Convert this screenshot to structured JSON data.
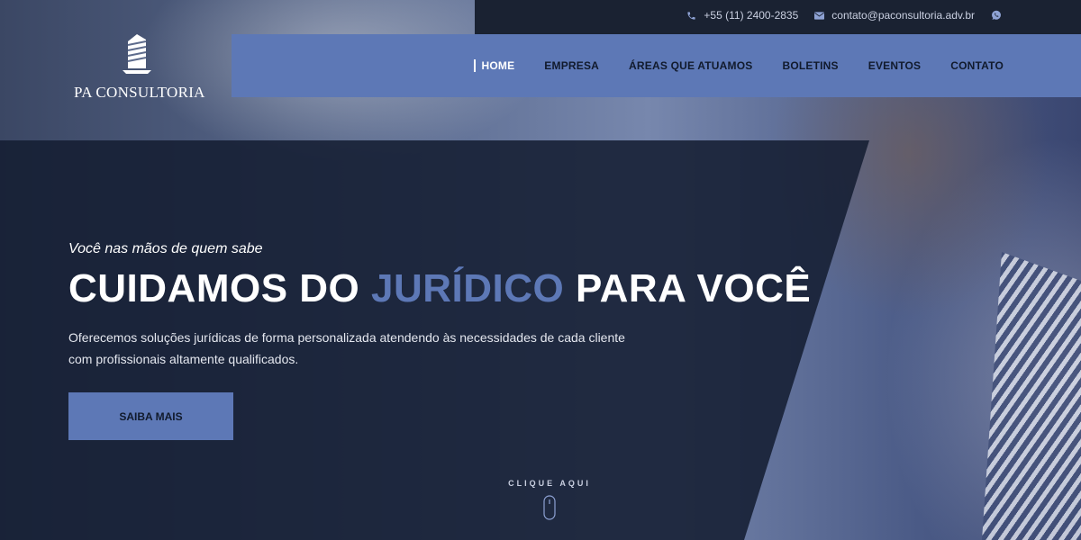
{
  "brand": {
    "name": "PA CONSULTORIA"
  },
  "contact": {
    "phone": "+55 (11) 2400-2835",
    "email": "contato@paconsultoria.adv.br"
  },
  "nav": {
    "items": [
      {
        "label": "HOME",
        "active": true
      },
      {
        "label": "EMPRESA"
      },
      {
        "label": "ÁREAS QUE ATUAMOS"
      },
      {
        "label": "BOLETINS"
      },
      {
        "label": "EVENTOS"
      },
      {
        "label": "CONTATO"
      }
    ]
  },
  "hero": {
    "tagline": "Você nas mãos de quem sabe",
    "headline_part1": "CUIDAMOS DO",
    "headline_accent": "JURÍDICO",
    "headline_part2": "PARA VOCÊ",
    "description": "Oferecemos soluções jurídicas de forma personalizada atendendo às necessidades de cada cliente com profissionais altamente qualificados.",
    "cta_label": "SAIBA MAIS",
    "scroll_label": "CLIQUE AQUI"
  },
  "colors": {
    "accent": "#5d78b6",
    "dark": "#1a2232",
    "overlay": "#141e32"
  }
}
